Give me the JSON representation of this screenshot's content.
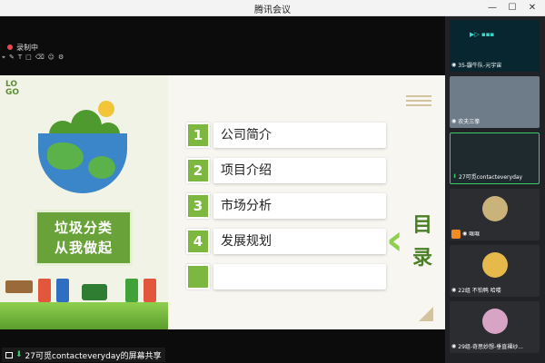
{
  "window": {
    "title": "腾讯会议"
  },
  "recording": {
    "label": "录制中"
  },
  "slide": {
    "logo": "LOGO",
    "slogan_line1": "垃圾分类",
    "slogan_line2": "从我做起",
    "menu": [
      {
        "num": "1",
        "label": "公司简介"
      },
      {
        "num": "2",
        "label": "项目介绍"
      },
      {
        "num": "3",
        "label": "市场分析"
      },
      {
        "num": "4",
        "label": "发展规划"
      },
      {
        "num": "",
        "label": ""
      }
    ],
    "mulu_top": "目",
    "mulu_bottom": "录"
  },
  "share_label": "27可觅contacteveryday的屏幕共享",
  "participants": [
    {
      "name": "35-鼹牛队-元宇宙",
      "mic": "muted"
    },
    {
      "name": "农夫三拳",
      "mic": "muted"
    },
    {
      "name": "27可觅contacteveryday",
      "mic": "active"
    },
    {
      "name": "哐哐",
      "mic": "muted"
    },
    {
      "name": "22组  不怕鸭  哈喽",
      "mic": "muted"
    },
    {
      "name": "29组-奇思妙想-垂直裸纱...",
      "mic": "muted"
    }
  ],
  "colors": {
    "accent_green": "#7cb83f",
    "mic_active": "#3ccb6b"
  }
}
